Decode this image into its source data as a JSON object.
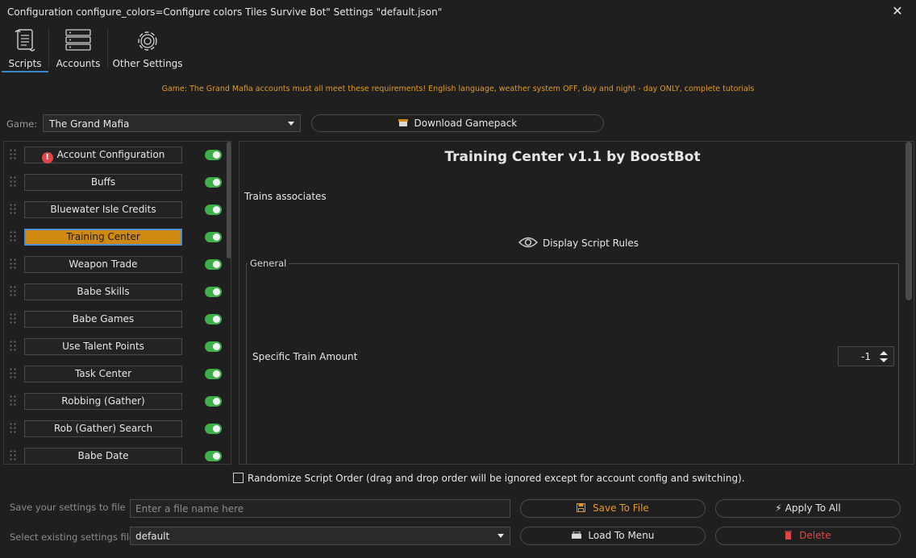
{
  "window": {
    "title": "Configuration configure_colors=Configure colors Tiles Survive Bot\" Settings \"default.json\""
  },
  "tabs": [
    {
      "label": "Scripts",
      "icon": "scroll-icon"
    },
    {
      "label": "Accounts",
      "icon": "server-icon"
    },
    {
      "label": "Other Settings",
      "icon": "gear-icon"
    }
  ],
  "notice": "Game: The Grand Mafia accounts must all meet these requirements! English language, weather system OFF, day and night - day ONLY, complete tutorials",
  "game": {
    "label": "Game:",
    "selected": "The Grand Mafia"
  },
  "download_button": "Download Gamepack",
  "scripts": [
    {
      "label": "Account Configuration",
      "enabled": true,
      "warning": true
    },
    {
      "label": "Buffs",
      "enabled": true
    },
    {
      "label": "Bluewater Isle Credits",
      "enabled": true
    },
    {
      "label": "Training Center",
      "enabled": true,
      "selected": true
    },
    {
      "label": "Weapon Trade",
      "enabled": true
    },
    {
      "label": "Babe Skills",
      "enabled": true
    },
    {
      "label": "Babe Games",
      "enabled": true
    },
    {
      "label": "Use Talent Points",
      "enabled": true
    },
    {
      "label": "Task Center",
      "enabled": true
    },
    {
      "label": "Robbing (Gather)",
      "enabled": true
    },
    {
      "label": "Rob (Gather) Search",
      "enabled": true
    },
    {
      "label": "Babe Date",
      "enabled": true
    }
  ],
  "detail": {
    "title": "Training Center v1.1 by BoostBot",
    "description": "Trains associates",
    "rules_button": "Display Script Rules",
    "group_label": "General",
    "fields": [
      {
        "label": "Specific Train Amount",
        "value": "-1"
      }
    ]
  },
  "randomize": {
    "label": "Randomize Script Order (drag and drop order will be ignored except for account config and switching).",
    "checked": false
  },
  "save_section": {
    "label": "Save your settings to file",
    "placeholder": "Enter a file name here",
    "save_button": "Save To File",
    "apply_button": "Apply To All"
  },
  "select_section": {
    "label": "Select existing settings file",
    "selected": "default",
    "load_button": "Load To Menu",
    "delete_button": "Delete"
  },
  "colors": {
    "accent": "#d08a12",
    "toggle_on": "#3eb04a",
    "warning": "#e04646",
    "notice": "#e09a2a",
    "selection_border": "#4d8fd6"
  }
}
